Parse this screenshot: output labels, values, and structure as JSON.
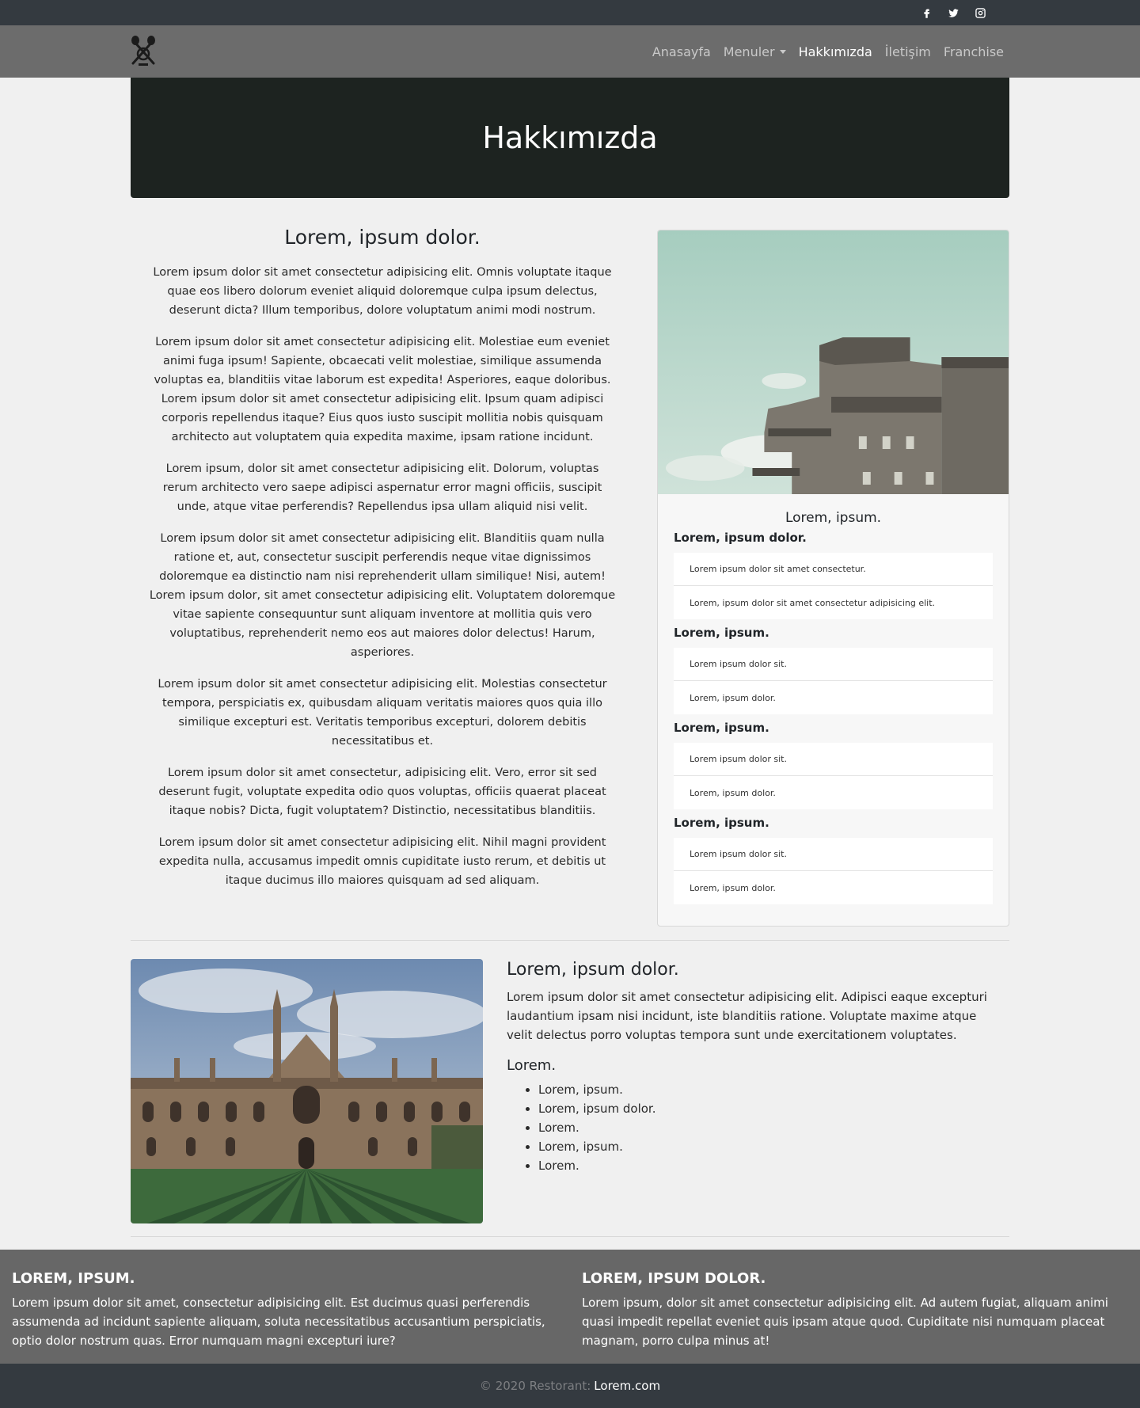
{
  "topbar": {
    "icons": [
      "facebook-icon",
      "twitter-icon",
      "instagram-icon"
    ]
  },
  "nav": {
    "logo": "crossed-utensils-logo",
    "items": [
      {
        "label": "Anasayfa"
      },
      {
        "label": "Menuler"
      },
      {
        "label": "Hakkımızda"
      },
      {
        "label": "İletişim"
      },
      {
        "label": "Franchise"
      }
    ],
    "active_index": 2
  },
  "hero": {
    "title": "Hakkımızda"
  },
  "intro": {
    "heading": "Lorem, ipsum dolor.",
    "paragraphs": [
      "Lorem ipsum dolor sit amet consectetur adipisicing elit. Omnis voluptate itaque quae eos libero dolorum eveniet aliquid doloremque culpa ipsum delectus, deserunt dicta? Illum temporibus, dolore voluptatum animi modi nostrum.",
      "Lorem ipsum dolor sit amet consectetur adipisicing elit. Molestiae eum eveniet animi fuga ipsum! Sapiente, obcaecati velit molestiae, similique assumenda voluptas ea, blanditiis vitae laborum est expedita! Asperiores, eaque doloribus. Lorem ipsum dolor sit amet consectetur adipisicing elit. Ipsum quam adipisci corporis repellendus itaque? Eius quos iusto suscipit mollitia nobis quisquam architecto aut voluptatem quia expedita maxime, ipsam ratione incidunt.",
      "Lorem ipsum, dolor sit amet consectetur adipisicing elit. Dolorum, voluptas rerum architecto vero saepe adipisci aspernatur error magni officiis, suscipit unde, atque vitae perferendis? Repellendus ipsa ullam aliquid nisi velit.",
      "Lorem ipsum dolor sit amet consectetur adipisicing elit. Blanditiis quam nulla ratione et, aut, consectetur suscipit perferendis neque vitae dignissimos doloremque ea distinctio nam nisi reprehenderit ullam similique! Nisi, autem! Lorem ipsum dolor, sit amet consectetur adipisicing elit. Voluptatem doloremque vitae sapiente consequuntur sunt aliquam inventore at mollitia quis vero voluptatibus, reprehenderit nemo eos aut maiores dolor delectus! Harum, asperiores.",
      "Lorem ipsum dolor sit amet consectetur adipisicing elit. Molestias consectetur tempora, perspiciatis ex, quibusdam aliquam veritatis maiores quos quia illo similique excepturi est. Veritatis temporibus excepturi, dolorem debitis necessitatibus et.",
      "Lorem ipsum dolor sit amet consectetur, adipisicing elit. Vero, error sit sed deserunt fugit, voluptate expedita odio quos voluptas, officiis quaerat placeat itaque nobis? Dicta, fugit voluptatem? Distinctio, necessitatibus blanditiis.",
      "Lorem ipsum dolor sit amet consectetur adipisicing elit. Nihil magni provident expedita nulla, accusamus impedit omnis cupiditate iusto rerum, et debitis ut itaque ducimus illo maiores quisquam ad sed aliquam."
    ]
  },
  "card": {
    "title": "Lorem, ipsum.",
    "groups": [
      {
        "title": "Lorem, ipsum dolor.",
        "items": [
          "Lorem ipsum dolor sit amet consectetur.",
          "Lorem, ipsum dolor sit amet consectetur adipisicing elit."
        ]
      },
      {
        "title": "Lorem, ipsum.",
        "items": [
          "Lorem ipsum dolor sit.",
          "Lorem, ipsum dolor."
        ]
      },
      {
        "title": "Lorem, ipsum.",
        "items": [
          "Lorem ipsum dolor sit.",
          "Lorem, ipsum dolor."
        ]
      },
      {
        "title": "Lorem, ipsum.",
        "items": [
          "Lorem ipsum dolor sit.",
          "Lorem, ipsum dolor."
        ]
      }
    ]
  },
  "section2": {
    "heading": "Lorem, ipsum dolor.",
    "paragraph": "Lorem ipsum dolor sit amet consectetur adipisicing elit. Adipisci eaque excepturi laudantium ipsam nisi incidunt, iste blanditiis ratione. Voluptate maxime atque velit delectus porro voluptas tempora sunt unde exercitationem voluptates.",
    "subheading": "Lorem.",
    "list": [
      "Lorem, ipsum.",
      "Lorem, ipsum dolor.",
      "Lorem.",
      "Lorem, ipsum.",
      "Lorem."
    ]
  },
  "footer": {
    "col1": {
      "title": "LOREM, IPSUM.",
      "text": "Lorem ipsum dolor sit amet, consectetur adipisicing elit. Est ducimus quasi perferendis assumenda ad incidunt sapiente aliquam, soluta necessitatibus accusantium perspiciatis, optio dolor nostrum quas. Error numquam magni excepturi iure?"
    },
    "col2": {
      "title": "LOREM, IPSUM DOLOR.",
      "text": "Lorem ipsum, dolor sit amet consectetur adipisicing elit. Ad autem fugiat, aliquam animi quasi impedit repellat eveniet quis ipsam atque quod. Cupiditate nisi numquam placeat magnam, porro culpa minus at!"
    },
    "copyright": "© 2020 Restorant:",
    "link": "Lorem.com"
  },
  "colors": {
    "topbar": "#343a40",
    "navbar": "#6c6c6c",
    "hero": "#1d2320",
    "footer_top": "#676767",
    "footer_bottom": "#343a40"
  }
}
